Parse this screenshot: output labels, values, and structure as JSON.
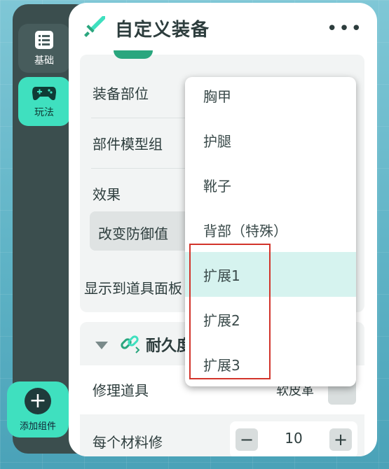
{
  "sidebar": {
    "items": [
      {
        "label": "基础",
        "icon": "list-icon"
      },
      {
        "label": "玩法",
        "icon": "gamepad-icon"
      }
    ],
    "add_component_label": "添加组件"
  },
  "panel": {
    "title": "自定义装备",
    "more_icon": "more-icon",
    "fields": {
      "slot_label": "装备部位",
      "model_group_label": "部件模型组",
      "effect_label": "效果",
      "effect_value": "改变防御值",
      "show_panel_label": "显示到道具面板"
    },
    "durability": {
      "title": "耐久度",
      "repair_label": "修理道具",
      "repair_value": "软皮革",
      "per_material_label": "每个材料修",
      "per_material_value": "10"
    }
  },
  "dropdown": {
    "options": [
      "胸甲",
      "护腿",
      "靴子",
      "背部（特殊）",
      "扩展1",
      "扩展2",
      "扩展3"
    ],
    "selected_index": 4
  },
  "colors": {
    "accent": "#3fe0bf",
    "sidebar_bg": "#3b4e4e",
    "selected_option_bg": "#d6f3ef",
    "annotation_red": "#d2342b"
  }
}
